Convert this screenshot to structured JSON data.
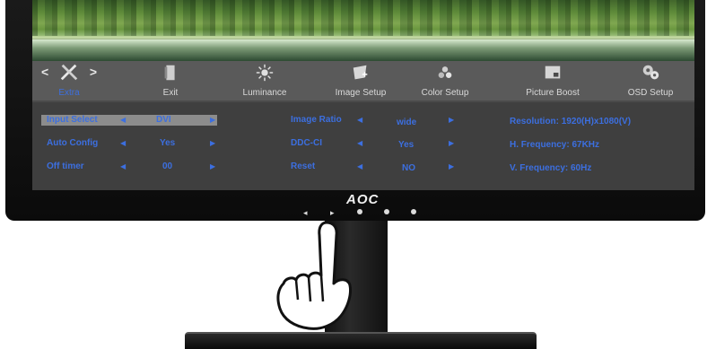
{
  "menu": {
    "tabs": [
      {
        "label": "Extra",
        "icon": "tools-icon"
      },
      {
        "label": "Exit",
        "icon": "exit-door-icon"
      },
      {
        "label": "Luminance",
        "icon": "sun-icon"
      },
      {
        "label": "Image Setup",
        "icon": "image-setup-icon"
      },
      {
        "label": "Color Setup",
        "icon": "color-dots-icon"
      },
      {
        "label": "Picture Boost",
        "icon": "picture-boost-icon"
      },
      {
        "label": "OSD Setup",
        "icon": "osd-gear-icon"
      }
    ],
    "active_tab": "Extra"
  },
  "settings": {
    "input_select": {
      "label": "Input Select",
      "value": "DVI"
    },
    "auto_config": {
      "label": "Auto Config",
      "value": "Yes"
    },
    "off_timer": {
      "label": "Off timer",
      "value": "00"
    },
    "image_ratio": {
      "label": "Image Ratio",
      "value": "wide"
    },
    "ddc_ci": {
      "label": "DDC-CI",
      "value": "Yes"
    },
    "reset": {
      "label": "Reset",
      "value": "NO"
    }
  },
  "info": {
    "resolution": "Resolution:  1920(H)x1080(V)",
    "h_frequency": "H. Frequency:  67KHz",
    "v_frequency": "V. Frequency:  60Hz"
  },
  "brand": {
    "logo": "AOC"
  },
  "colors": {
    "accent": "#3c6fe0",
    "panel": "#3f3f3f",
    "tabbar": "#5a5a5a",
    "highlight": "#8c8c8c"
  }
}
